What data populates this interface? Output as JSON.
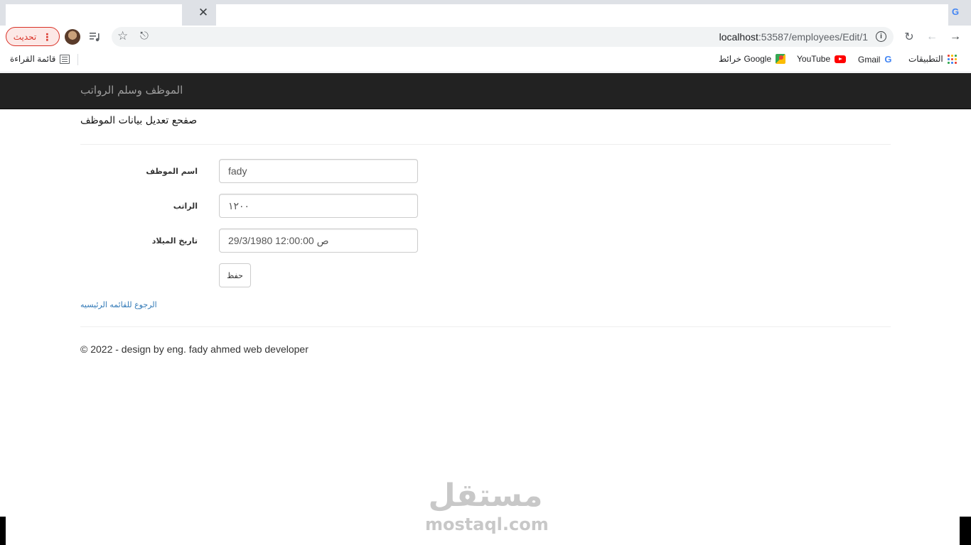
{
  "browser": {
    "address": {
      "host": "localhost",
      "path": ":53587/employees/Edit/1"
    },
    "update_button_label": "تحديث",
    "bookmarks": {
      "apps": "التطبيقات",
      "gmail": "Gmail",
      "youtube": "YouTube",
      "maps": "خرائط Google",
      "reading_list": "قائمة القراءة"
    }
  },
  "navbar": {
    "brand": "الموظف وسلم الرواتب"
  },
  "page": {
    "title": "صفحع تعديل بيانات الموظف",
    "form": {
      "name_label": "اسم الموظف",
      "name_value": "fady",
      "salary_label": "الراتب",
      "salary_value": "١٢٠٠",
      "birth_label": "تاريخ الميلاد",
      "birth_value": "29/3/1980 12:00:00 ص",
      "save_label": "حفظ"
    },
    "back_link": "الرجوع للقائمه الرئيسيه",
    "footer": "© 2022 - design by eng. fady ahmed web developer"
  },
  "watermark": {
    "arabic": "مستقل",
    "latin": "mostaql.com"
  },
  "colors": {
    "navbar_bg": "#222222",
    "brand_text": "#9d9d9d",
    "link": "#337ab7",
    "update_accent": "#d93025"
  },
  "icons": [
    "close-icon",
    "google-favicon-icon",
    "kebab-menu-icon",
    "avatar",
    "media-queue-icon",
    "star-icon",
    "share-icon",
    "info-icon",
    "reload-icon",
    "back-arrow-icon",
    "forward-arrow-icon",
    "apps-grid-icon",
    "gmail-icon",
    "youtube-icon",
    "maps-icon",
    "reading-list-icon"
  ]
}
